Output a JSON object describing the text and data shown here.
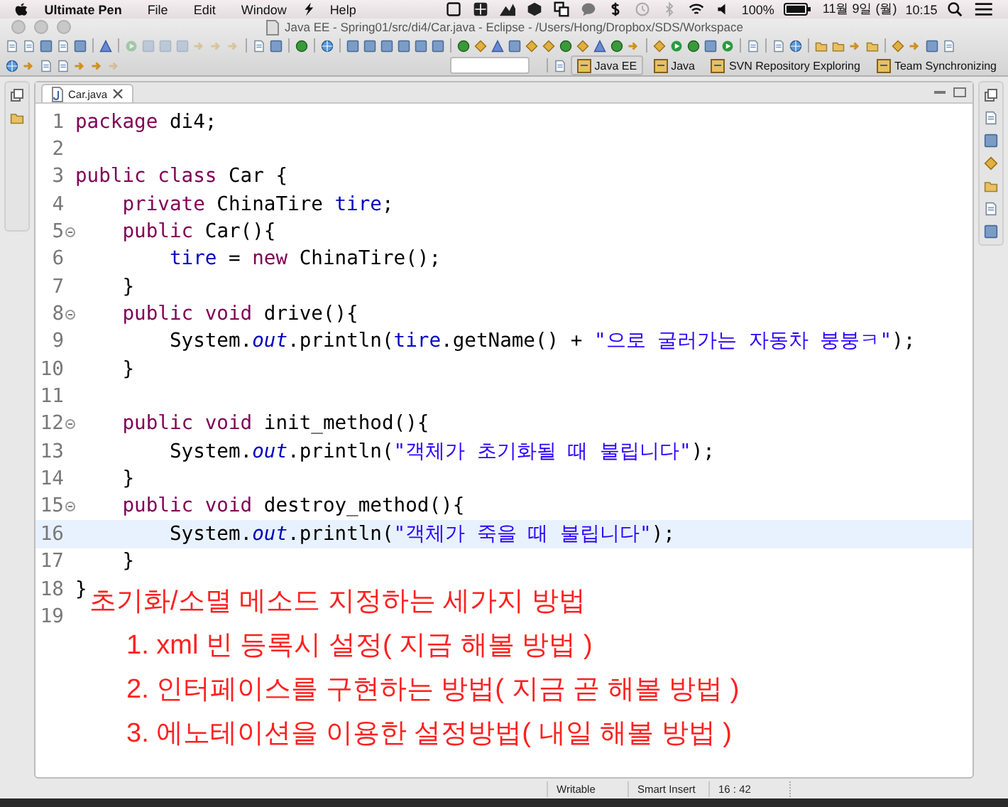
{
  "menu_bar": {
    "app_name": "Ultimate Pen",
    "menus": [
      "File",
      "Edit",
      "Window",
      "Help"
    ],
    "battery": "100%",
    "date": "11월 9일 (월)",
    "time": "10:15"
  },
  "window": {
    "title": "Java EE - Spring01/src/di4/Car.java - Eclipse - /Users/Hong/Dropbox/SDS/Workspace"
  },
  "perspectives": [
    {
      "label": "Java EE",
      "selected": true
    },
    {
      "label": "Java",
      "selected": false
    },
    {
      "label": "SVN Repository Exploring",
      "selected": false
    },
    {
      "label": "Team Synchronizing",
      "selected": false
    }
  ],
  "editor": {
    "tabs": [
      {
        "label": "Car.java",
        "selected": true
      }
    ],
    "lines": [
      {
        "number": "1",
        "fold": false,
        "current": false,
        "tokens": [
          {
            "kind": "keyword",
            "text": "package"
          },
          {
            "kind": "plain",
            "text": " di4;"
          }
        ]
      },
      {
        "number": "2",
        "fold": false,
        "current": false
      },
      {
        "number": "3",
        "fold": false,
        "current": false,
        "tokens": [
          {
            "kind": "keyword",
            "text": "public class"
          },
          {
            "kind": "plain",
            "text": " Car {"
          }
        ]
      },
      {
        "number": "4",
        "fold": false,
        "current": false,
        "tokens": [
          {
            "kind": "keyword",
            "text": "    private"
          },
          {
            "kind": "plain",
            "text": " ChinaTire "
          },
          {
            "kind": "field",
            "text": "tire"
          },
          {
            "kind": "plain",
            "text": ";"
          }
        ]
      },
      {
        "number": "5",
        "fold": true,
        "current": false,
        "tokens": [
          {
            "kind": "keyword",
            "text": "    public"
          },
          {
            "kind": "plain",
            "text": " Car(){"
          }
        ]
      },
      {
        "number": "6",
        "fold": false,
        "current": false,
        "tokens": [
          {
            "kind": "field",
            "text": "        tire"
          },
          {
            "kind": "plain",
            "text": " = "
          },
          {
            "kind": "keyword",
            "text": "new"
          },
          {
            "kind": "plain",
            "text": " ChinaTire();"
          }
        ]
      },
      {
        "number": "7",
        "fold": false,
        "current": false,
        "tokens": [
          {
            "kind": "plain",
            "text": "    }"
          }
        ]
      },
      {
        "number": "8",
        "fold": true,
        "current": false,
        "tokens": [
          {
            "kind": "keyword",
            "text": "    public void"
          },
          {
            "kind": "plain",
            "text": " drive(){"
          }
        ]
      },
      {
        "number": "9",
        "fold": false,
        "current": false,
        "tokens": [
          {
            "kind": "plain",
            "text": "        System."
          },
          {
            "kind": "static",
            "text": "out"
          },
          {
            "kind": "plain",
            "text": ".println("
          },
          {
            "kind": "field",
            "text": "tire"
          },
          {
            "kind": "plain",
            "text": ".getName() + "
          },
          {
            "kind": "string",
            "text": "\"으로 굴러가는 자동차 붕붕ㅋ\""
          },
          {
            "kind": "plain",
            "text": ");"
          }
        ]
      },
      {
        "number": "10",
        "fold": false,
        "current": false,
        "tokens": [
          {
            "kind": "plain",
            "text": "    }"
          }
        ]
      },
      {
        "number": "11",
        "fold": false,
        "current": false
      },
      {
        "number": "12",
        "fold": true,
        "current": false,
        "tokens": [
          {
            "kind": "keyword",
            "text": "    public void"
          },
          {
            "kind": "plain",
            "text": " init_method(){"
          }
        ]
      },
      {
        "number": "13",
        "fold": false,
        "current": false,
        "tokens": [
          {
            "kind": "plain",
            "text": "        System."
          },
          {
            "kind": "static",
            "text": "out"
          },
          {
            "kind": "plain",
            "text": ".println("
          },
          {
            "kind": "string",
            "text": "\"객체가 초기화될 때 불립니다\""
          },
          {
            "kind": "plain",
            "text": ");"
          }
        ]
      },
      {
        "number": "14",
        "fold": false,
        "current": false,
        "tokens": [
          {
            "kind": "plain",
            "text": "    }"
          }
        ]
      },
      {
        "number": "15",
        "fold": true,
        "current": false,
        "tokens": [
          {
            "kind": "keyword",
            "text": "    public void"
          },
          {
            "kind": "plain",
            "text": " destroy_method(){"
          }
        ]
      },
      {
        "number": "16",
        "fold": false,
        "current": true,
        "tokens": [
          {
            "kind": "plain",
            "text": "        System."
          },
          {
            "kind": "static",
            "text": "out"
          },
          {
            "kind": "plain",
            "text": ".println("
          },
          {
            "kind": "string",
            "text": "\"객체가 죽을 때 불립니다\""
          },
          {
            "kind": "plain",
            "text": ");"
          }
        ]
      },
      {
        "number": "17",
        "fold": false,
        "current": false,
        "tokens": [
          {
            "kind": "plain",
            "text": "    }"
          }
        ]
      },
      {
        "number": "18",
        "fold": false,
        "current": false,
        "tokens": [
          {
            "kind": "plain",
            "text": "}"
          }
        ]
      },
      {
        "number": "19",
        "fold": false,
        "current": false
      }
    ],
    "annotation": {
      "heading": "초기화/소멸 메소드 지정하는 세가지 방법",
      "items": [
        "1. xml 빈 등록시 설정( 지금 해볼 방법 )",
        "2. 인터페이스를 구현하는 방법( 지금 곧 해볼 방법 )",
        "3. 에노테이션을 이용한 설정방법( 내일 해볼 방법 )"
      ]
    }
  },
  "status_bar": [
    "Writable",
    "Smart Insert",
    "16 : 42"
  ]
}
